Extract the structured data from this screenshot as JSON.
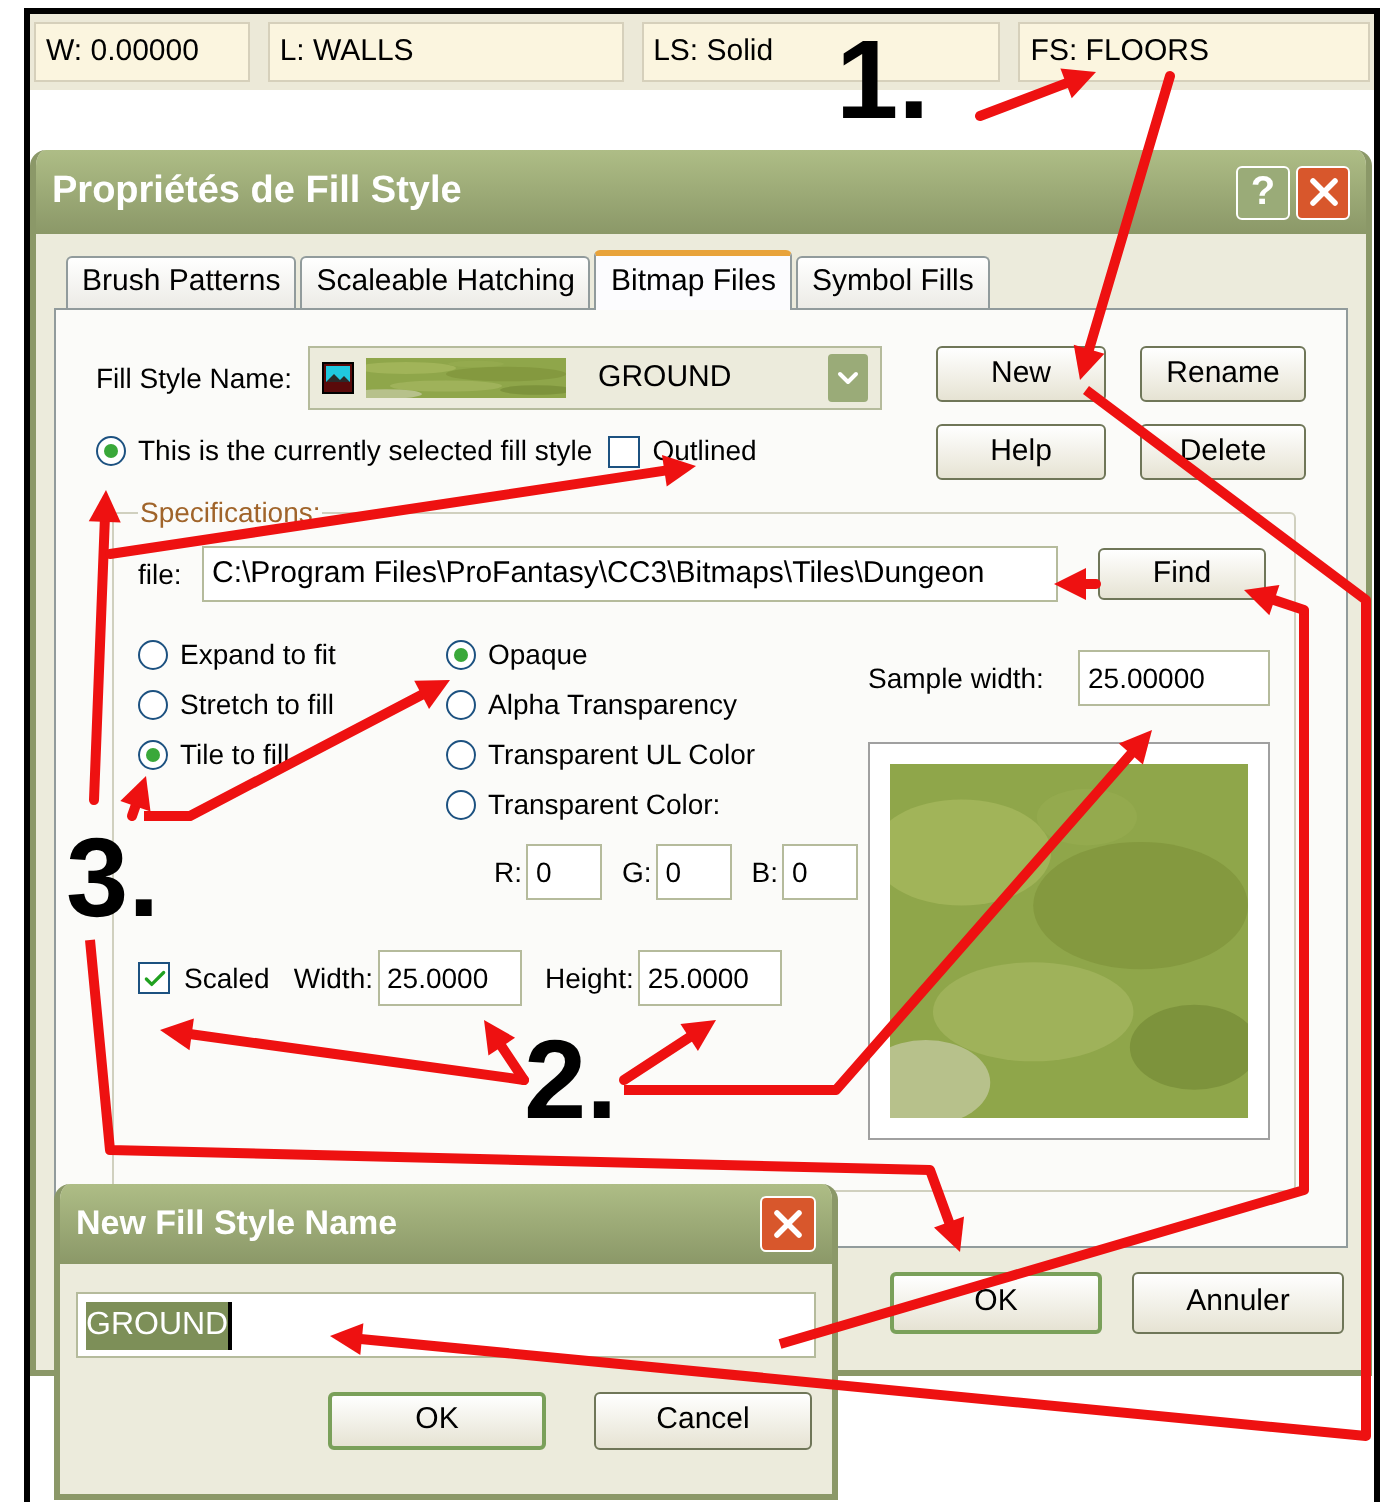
{
  "status_bar": [
    "W: 0.00000",
    "L: WALLS",
    "LS: Solid",
    "FS: FLOORS"
  ],
  "dialog": {
    "title": "Propriétés de Fill Style",
    "help_button": "?",
    "tabs": [
      {
        "label": "Brush Patterns",
        "selected": false
      },
      {
        "label": "Scaleable Hatching",
        "selected": false
      },
      {
        "label": "Bitmap Files",
        "selected": true
      },
      {
        "label": "Symbol Fills",
        "selected": false
      }
    ],
    "fill_style_name": {
      "label": "Fill Style Name:",
      "value": "GROUND"
    },
    "buttons": [
      "New",
      "Rename",
      "Help",
      "Delete"
    ],
    "current_style": {
      "label": "This is the currently selected fill style",
      "selected": true
    },
    "outlined": {
      "label": "Outlined",
      "checked": false
    },
    "specifications": {
      "title": "Specifications:",
      "file": {
        "label": "file:",
        "value": "C:\\Program Files\\ProFantasy\\CC3\\Bitmaps\\Tiles\\Dungeon"
      },
      "find_button": "Find",
      "fit_options": [
        {
          "label": "Expand to fit",
          "selected": false
        },
        {
          "label": "Stretch to fill",
          "selected": false
        },
        {
          "label": "Tile to fill",
          "selected": true
        }
      ],
      "transparency_options": [
        {
          "label": "Opaque",
          "selected": true
        },
        {
          "label": "Alpha Transparency",
          "selected": false
        },
        {
          "label": "Transparent UL Color",
          "selected": false
        },
        {
          "label": "Transparent Color:",
          "selected": false
        }
      ],
      "rgb": [
        {
          "label": "R:",
          "value": "0"
        },
        {
          "label": "G:",
          "value": "0"
        },
        {
          "label": "B:",
          "value": "0"
        }
      ],
      "sample_width": {
        "label": "Sample width:",
        "value": "25.00000"
      },
      "scaled": {
        "label": "Scaled",
        "checked": true
      },
      "width": {
        "label": "Width:",
        "value": "25.0000"
      },
      "height": {
        "label": "Height:",
        "value": "25.0000"
      }
    },
    "footer_buttons": [
      {
        "label": "OK",
        "default": true
      },
      {
        "label": "Annuler",
        "default": false
      }
    ]
  },
  "new_name_dialog": {
    "title": "New Fill Style Name",
    "value": "GROUND",
    "value_selected": true,
    "buttons": [
      {
        "label": "OK",
        "default": true
      },
      {
        "label": "Cancel",
        "default": false
      }
    ]
  },
  "annotations": [
    "1.",
    "2.",
    "3."
  ]
}
